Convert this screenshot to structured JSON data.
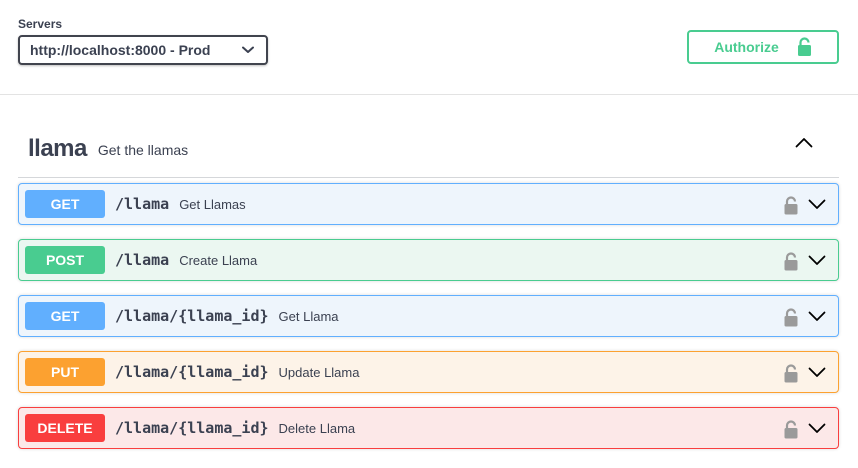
{
  "servers": {
    "label": "Servers",
    "selected": "http://localhost:8000 - Prod"
  },
  "authorize": {
    "label": "Authorize"
  },
  "tag": {
    "name": "llama",
    "description": "Get the llamas"
  },
  "operations": [
    {
      "method": "GET",
      "path": "/llama",
      "summary": "Get Llamas",
      "color": "#61affe",
      "bg": "#eef5fc"
    },
    {
      "method": "POST",
      "path": "/llama",
      "summary": "Create Llama",
      "color": "#49cc90",
      "bg": "#ebf7f1"
    },
    {
      "method": "GET",
      "path": "/llama/{llama_id}",
      "summary": "Get Llama",
      "color": "#61affe",
      "bg": "#eef5fc"
    },
    {
      "method": "PUT",
      "path": "/llama/{llama_id}",
      "summary": "Update Llama",
      "color": "#fca130",
      "bg": "#fdf3e8"
    },
    {
      "method": "DELETE",
      "path": "/llama/{llama_id}",
      "summary": "Delete Llama",
      "color": "#f93e3e",
      "bg": "#fce8e8"
    }
  ],
  "colors": {
    "authorize_green": "#49cc90",
    "text": "#3b4151"
  }
}
